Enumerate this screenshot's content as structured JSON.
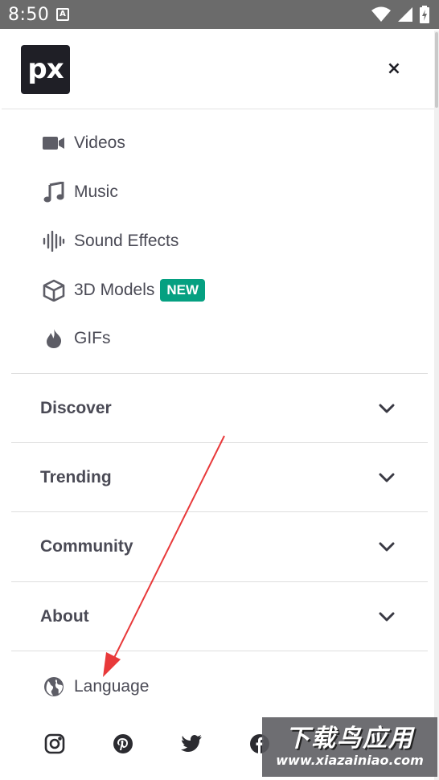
{
  "status_bar": {
    "time": "8:50",
    "a_icon_label": "A"
  },
  "header": {
    "logo_text": "px",
    "close_label": "×"
  },
  "media_menu": [
    {
      "label": "Videos",
      "icon": "video-camera-icon"
    },
    {
      "label": "Music",
      "icon": "music-note-icon"
    },
    {
      "label": "Sound Effects",
      "icon": "sound-wave-icon"
    },
    {
      "label": "3D Models",
      "icon": "cube-icon",
      "badge": "NEW"
    },
    {
      "label": "GIFs",
      "icon": "flame-icon"
    }
  ],
  "sections": [
    {
      "label": "Discover",
      "icon": "chevron-down-icon"
    },
    {
      "label": "Trending",
      "icon": "chevron-down-icon"
    },
    {
      "label": "Community",
      "icon": "chevron-down-icon"
    },
    {
      "label": "About",
      "icon": "chevron-down-icon"
    }
  ],
  "language": {
    "label": "Language",
    "icon": "globe-icon"
  },
  "socials": [
    "instagram-icon",
    "pinterest-icon",
    "twitter-icon",
    "facebook-icon"
  ],
  "watermark": {
    "title": "下载鸟应用",
    "url": "www.xiazainiao.com"
  },
  "colors": {
    "badge_green": "#05a081",
    "text": "#4a4a55",
    "logo_bg": "#1f1f26",
    "annotation_red": "#e8393a"
  }
}
